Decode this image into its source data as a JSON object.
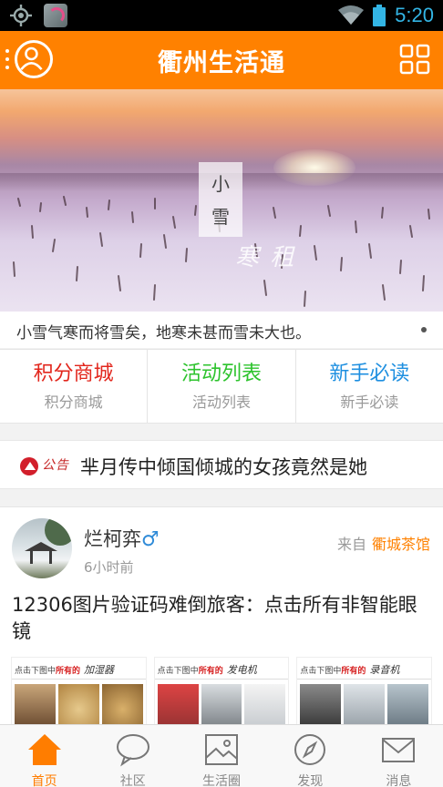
{
  "status_bar": {
    "time": "5:20",
    "icons": [
      "location-icon",
      "app-notification-icon",
      "wifi-icon",
      "battery-icon"
    ]
  },
  "header": {
    "title": "衢州生活通",
    "left_icon": "user-avatar-icon",
    "right_icon": "grid-menu-icon",
    "color": "#ff8100"
  },
  "banner": {
    "stamp_text": [
      "小",
      "雪"
    ],
    "script_text": "寒  租",
    "caption": "小雪气寒而将雪矣，地寒未甚而雪未大也。"
  },
  "quick_links": [
    {
      "title": "积分商城",
      "subtitle": "积分商城",
      "color": "#e2261c"
    },
    {
      "title": "活动列表",
      "subtitle": "活动列表",
      "color": "#2dc32d"
    },
    {
      "title": "新手必读",
      "subtitle": "新手必读",
      "color": "#1e8fe0"
    }
  ],
  "notice": {
    "tag": "公告",
    "text": "芈月传中倾国倾城的女孩竟然是她"
  },
  "post": {
    "author": "烂柯弈",
    "gender_symbol": "♂",
    "time": "6小时前",
    "from_label": "来自",
    "from_link": "衢城茶馆",
    "title": "12306图片验证码难倒旅客：点击所有非智能眼镜",
    "thumbnails": [
      {
        "prefix": "点击下图中",
        "highlight": "所有的",
        "signature": "加湿器"
      },
      {
        "prefix": "点击下图中",
        "highlight": "所有的",
        "signature": "发电机"
      },
      {
        "prefix": "点击下图中",
        "highlight": "所有的",
        "signature": "录音机"
      }
    ]
  },
  "tabs": [
    {
      "label": "首页",
      "icon": "home-icon",
      "active": true
    },
    {
      "label": "社区",
      "icon": "chat-bubble-icon",
      "active": false
    },
    {
      "label": "生活圈",
      "icon": "picture-icon",
      "active": false
    },
    {
      "label": "发现",
      "icon": "compass-icon",
      "active": false
    },
    {
      "label": "消息",
      "icon": "mail-icon",
      "active": false
    }
  ],
  "colors": {
    "accent": "#ff8100",
    "active_tab": "#ff7d00",
    "gender": "#2f8bd8"
  }
}
